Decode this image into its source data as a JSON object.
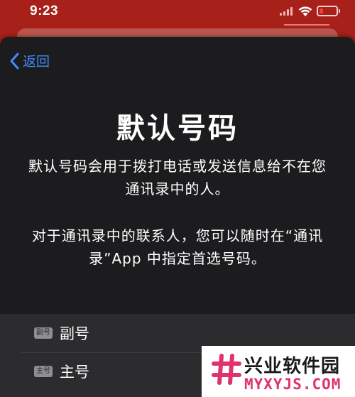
{
  "status_bar": {
    "time": "9:23",
    "battery_color": "#ff3b30"
  },
  "nav": {
    "back_label": "返回"
  },
  "content": {
    "title": "默认号码",
    "description_1": "默认号码会用于拨打电话或发送信息给不在您通讯录中的人。",
    "description_2": "对于通讯录中的联系人，您可以随时在“通讯录”App 中指定首选号码。"
  },
  "lines": [
    {
      "badge": "副号",
      "label": "副号"
    },
    {
      "badge": "主号",
      "label": "主号"
    }
  ],
  "watermark": {
    "title": "兴业软件园",
    "url": "MYXYJS.COM",
    "accent_color": "#e0336b"
  },
  "colors": {
    "accent_blue": "#3f8cff",
    "sheet_bg": "#1c1c1e",
    "wallpaper": "#a8201a"
  }
}
